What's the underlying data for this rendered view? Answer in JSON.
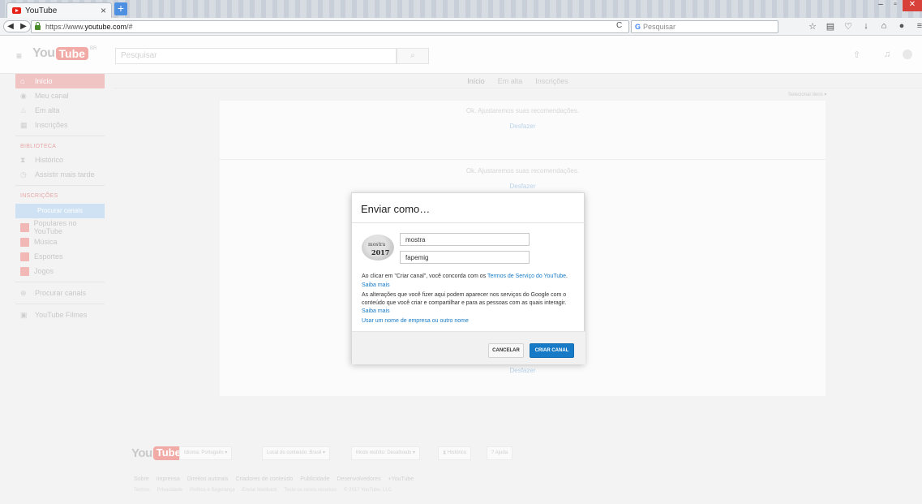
{
  "browser": {
    "tab_title": "YouTube",
    "tab_close": "×",
    "new_tab": "+",
    "url_prefix": "https://www.",
    "url_domain": "youtube.com",
    "url_suffix": "/#",
    "search_placeholder": "Pesquisar",
    "window_controls": [
      "–",
      "▫",
      "✕"
    ]
  },
  "yt": {
    "logo_you": "You",
    "logo_tube": "Tube",
    "logo_sup": "BR",
    "search_placeholder": "Pesquisar",
    "tabs": [
      "Início",
      "Em alta",
      "Inscrições"
    ],
    "select_items": "Selecionar itens ▾",
    "sidebar": {
      "items": [
        "Início",
        "Meu canal",
        "Em alta",
        "Inscrições"
      ],
      "biblioteca_head": "BIBLIOTECA",
      "biblioteca_items": [
        "Histórico",
        "Assistir mais tarde"
      ],
      "inscricoes_head": "INSCRIÇÕES",
      "browse_button": "Procurar canais",
      "channels": [
        "Populares no YouTube",
        "Música",
        "Esportes",
        "Jogos"
      ],
      "extra": [
        "Procurar canais",
        "YouTube Filmes"
      ]
    },
    "feed": {
      "message": "Ok. Ajustaremos suas recomendações.",
      "undo": "Desfazer"
    },
    "footer": {
      "language": "Idioma: Português ▾",
      "location": "Local do conteúdo: Brasil ▾",
      "restricted": "Modo restrito: Desativado ▾",
      "history": "Histórico",
      "help": "Ajuda",
      "links": [
        "Sobre",
        "Imprensa",
        "Direitos autorais",
        "Criadores de conteúdo",
        "Publicidade",
        "Desenvolvedores",
        "+YouTube"
      ],
      "links2": [
        "Termos",
        "Privacidade",
        "Política e Segurança",
        "Enviar feedback",
        "Teste os novos recursos",
        "© 2017 YouTube, LLC"
      ]
    }
  },
  "modal": {
    "title": "Enviar como…",
    "avatar_line1": "mostra",
    "avatar_line2": "2017",
    "first_name": "mostra",
    "last_name": "fapemig",
    "terms_pre": "Ao clicar em \"Criar canal\", você concorda com os ",
    "terms_link": "Termos de Serviço do YouTube",
    "terms_post": ".",
    "learn_more_1": "Saiba mais",
    "notice": "As alterações que você fizer aqui podem aparecer nos serviços do Google com o conteúdo que você criar e compartilhar e para as pessoas com as quais interagir.",
    "learn_more_2": "Saiba mais",
    "use_business_name": "Usar um nome de empresa ou outro nome",
    "cancel_label": "CANCELAR",
    "create_label": "CRIAR CANAL"
  }
}
